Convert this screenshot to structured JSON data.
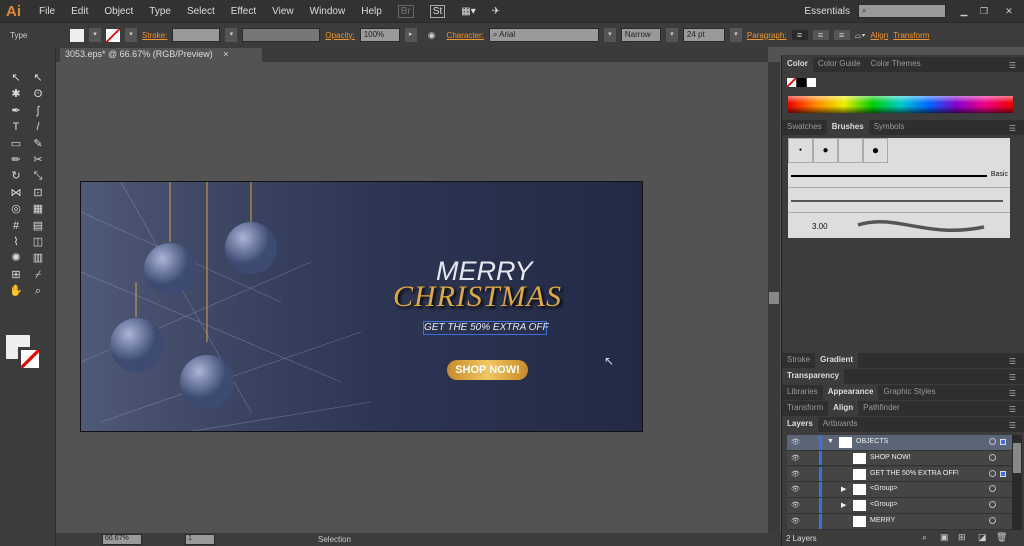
{
  "app": {
    "logo": "Ai",
    "menu": [
      "File",
      "Edit",
      "Object",
      "Type",
      "Select",
      "Effect",
      "View",
      "Window",
      "Help"
    ],
    "workspace": "Essentials"
  },
  "control": {
    "tool": "Type",
    "stroke_label": "Stroke:",
    "opacity_label": "Opacity:",
    "opacity": "100%",
    "character_label": "Character:",
    "font": "Arial",
    "font_style": "Narrow ...",
    "font_size": "24 pt",
    "paragraph_label": "Paragraph:",
    "align_label": "Align",
    "transform_label": "Transform"
  },
  "document": {
    "tab": "3053.eps* @ 66.67% (RGB/Preview)"
  },
  "artwork": {
    "line1": "MERRY",
    "line2": "CHRISTMAS",
    "line3": "GET THE 50% EXTRA OFF",
    "button": "SHOP NOW!"
  },
  "status": {
    "zoom": "66.67%",
    "artboard": "1",
    "tool": "Selection"
  },
  "panels": {
    "color_tabs": [
      "Color",
      "Color Guide",
      "Color Themes"
    ],
    "brush_tabs": [
      "Swatches",
      "Brushes",
      "Symbols"
    ],
    "brush_basic": "Basic",
    "brush_size": "3.00",
    "stroke_tabs": [
      "Stroke",
      "Gradient"
    ],
    "transparency_tab": "Transparency",
    "appearance_tabs": [
      "Libraries",
      "Appearance",
      "Graphic Styles"
    ],
    "align_tabs": [
      "Transform",
      "Align",
      "Pathfinder"
    ],
    "layers_tabs": [
      "Layers",
      "Artboards"
    ],
    "layers": [
      {
        "name": "OBJECTS",
        "expanded": true
      },
      {
        "name": "SHOP NOW!"
      },
      {
        "name": "GET THE 50% EXTRA OFF!"
      },
      {
        "name": "<Group>"
      },
      {
        "name": "<Group>"
      },
      {
        "name": "MERRY"
      }
    ],
    "layers_count": "2 Layers"
  },
  "colors": {
    "accent": "#f0962e",
    "selection": "#3c6fe0",
    "gold": "#d9a13a"
  }
}
